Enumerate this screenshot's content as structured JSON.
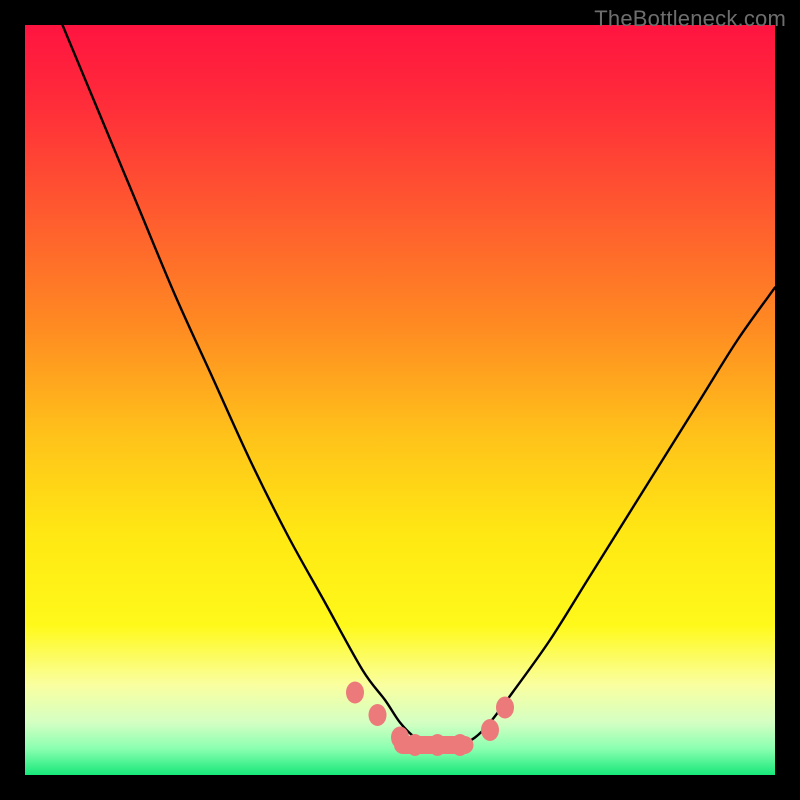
{
  "watermark": "TheBottleneck.com",
  "chart_data": {
    "type": "line",
    "title": "",
    "xlabel": "",
    "ylabel": "",
    "xlim": [
      0,
      100
    ],
    "ylim": [
      0,
      100
    ],
    "background_gradient": {
      "stops": [
        {
          "offset": 0.0,
          "color": "#ff1440"
        },
        {
          "offset": 0.1,
          "color": "#ff2b3a"
        },
        {
          "offset": 0.25,
          "color": "#ff5a2f"
        },
        {
          "offset": 0.4,
          "color": "#ff8a22"
        },
        {
          "offset": 0.55,
          "color": "#ffc31a"
        },
        {
          "offset": 0.68,
          "color": "#ffe813"
        },
        {
          "offset": 0.8,
          "color": "#fff91a"
        },
        {
          "offset": 0.88,
          "color": "#faffa0"
        },
        {
          "offset": 0.93,
          "color": "#d4ffc3"
        },
        {
          "offset": 0.965,
          "color": "#8affb0"
        },
        {
          "offset": 1.0,
          "color": "#17e879"
        }
      ]
    },
    "series": [
      {
        "name": "bottleneck-curve",
        "color": "#000000",
        "x": [
          5,
          10,
          15,
          20,
          25,
          30,
          35,
          40,
          45,
          48,
          50,
          52,
          54,
          56,
          58,
          60,
          62,
          65,
          70,
          75,
          80,
          85,
          90,
          95,
          100
        ],
        "y": [
          100,
          88,
          76,
          64,
          53,
          42,
          32,
          23,
          14,
          10,
          7,
          5,
          4,
          4,
          4,
          5,
          7,
          11,
          18,
          26,
          34,
          42,
          50,
          58,
          65
        ]
      }
    ],
    "markers": {
      "name": "highlight-points",
      "color": "#ed7a7a",
      "points": [
        {
          "x": 44,
          "y": 11
        },
        {
          "x": 47,
          "y": 8
        },
        {
          "x": 50,
          "y": 5
        },
        {
          "x": 52,
          "y": 4
        },
        {
          "x": 55,
          "y": 4
        },
        {
          "x": 58,
          "y": 4
        },
        {
          "x": 62,
          "y": 6
        },
        {
          "x": 64,
          "y": 9
        }
      ]
    }
  }
}
